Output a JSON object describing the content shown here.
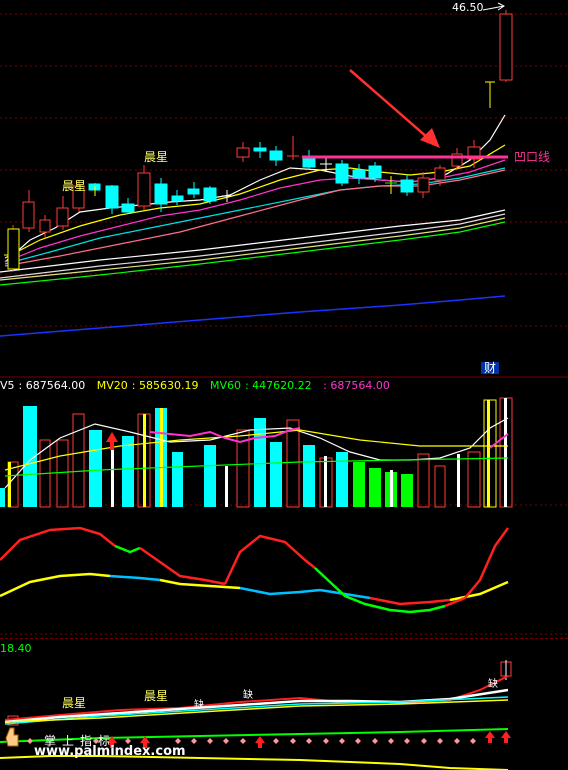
{
  "colors": {
    "bg": "#000000",
    "grid": "#7a0000",
    "up": "#ff3b3b",
    "down": "#00ffff",
    "ma_white": "#ffffff",
    "ma_yellow": "#ffff00",
    "ma_magenta": "#ff33cc",
    "ma_green": "#00ff00",
    "ma_blue": "#1a33ff",
    "label_yellow": "#ffff66",
    "label_green": "#22ff22",
    "annot_pink": "#ff3399",
    "value_white": "#ffffff"
  },
  "price_panel": {
    "high_label": "46.50",
    "pattern_labels": [
      "晨星",
      "晨星"
    ],
    "line_label": "凹口线",
    "event_label": "财"
  },
  "volume_panel": {
    "indicators": [
      {
        "name": "V5",
        "value": "687564.00",
        "color": "#ffffff"
      },
      {
        "name": "MV20",
        "value": "585630.19",
        "color": "#ffff00"
      },
      {
        "name": "MV60",
        "value": "447620.22",
        "color": "#00ff00"
      },
      {
        "name": "",
        "value": "687564.00",
        "color": "#ff33cc"
      }
    ]
  },
  "lower_panel": {
    "value_label": "18.40",
    "pattern_labels": [
      "晨星",
      "晨星",
      "缺",
      "缺",
      "缺"
    ],
    "footer_label": "掌上指标"
  },
  "watermark": "www.palmindex.com",
  "icons": [
    "hand-cursor-icon",
    "up-arrow-icon",
    "diamond-marker-icon"
  ]
}
